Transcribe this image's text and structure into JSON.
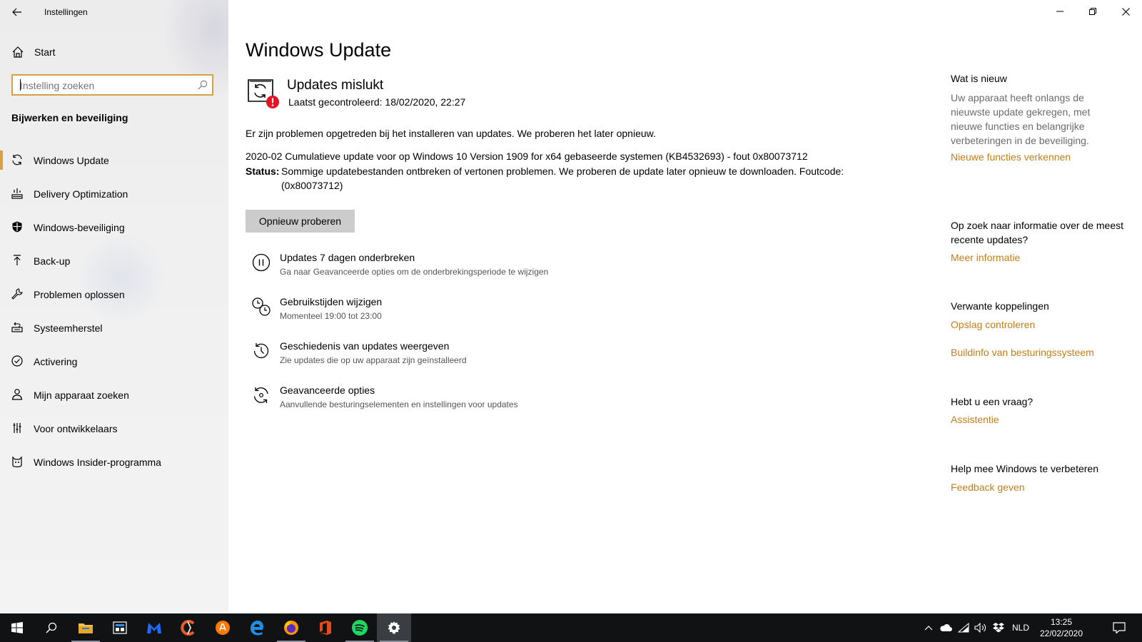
{
  "window": {
    "title": "Instellingen"
  },
  "sidebar": {
    "home_label": "Start",
    "search_placeholder": "Instelling zoeken",
    "section_title": "Bijwerken en beveiliging",
    "items": [
      {
        "label": "Windows Update",
        "icon": "sync-icon",
        "active": true
      },
      {
        "label": "Delivery Optimization",
        "icon": "delivery-icon"
      },
      {
        "label": "Windows-beveiliging",
        "icon": "shield-icon"
      },
      {
        "label": "Back-up",
        "icon": "backup-arrow-icon"
      },
      {
        "label": "Problemen oplossen",
        "icon": "wrench-icon"
      },
      {
        "label": "Systeemherstel",
        "icon": "recovery-icon"
      },
      {
        "label": "Activering",
        "icon": "check-circle-icon"
      },
      {
        "label": "Mijn apparaat zoeken",
        "icon": "person-find-icon"
      },
      {
        "label": "Voor ontwikkelaars",
        "icon": "developer-icon"
      },
      {
        "label": "Windows Insider-programma",
        "icon": "insider-cat-icon"
      }
    ]
  },
  "main": {
    "page_title": "Windows Update",
    "status_title": "Updates mislukt",
    "last_checked": "Laatst gecontroleerd: 18/02/2020, 22:27",
    "problem_text": "Er zijn problemen opgetreden bij het installeren van updates. We proberen het later opnieuw.",
    "update_name": "2020-02 Cumulatieve update voor op Windows 10 Version 1909 for x64 gebaseerde systemen (KB4532693) - fout 0x80073712",
    "status_label": "Status:",
    "status_value_line1": "Sommige updatebestanden ontbreken of vertonen problemen. We proberen de update later opnieuw te downloaden. Foutcode:",
    "status_value_line2": "(0x80073712)",
    "retry_button": "Opnieuw proberen",
    "options": [
      {
        "title": "Updates 7 dagen onderbreken",
        "subtitle": "Ga naar Geavanceerde opties om de onderbrekingsperiode te wijzigen",
        "icon": "pause-icon"
      },
      {
        "title": "Gebruikstijden wijzigen",
        "subtitle": "Momenteel 19:00 tot 23:00",
        "icon": "active-hours-icon"
      },
      {
        "title": "Geschiedenis van updates weergeven",
        "subtitle": "Zie updates die op uw apparaat zijn geïnstalleerd",
        "icon": "history-icon"
      },
      {
        "title": "Geavanceerde opties",
        "subtitle": "Aanvullende besturingselementen en instellingen voor updates",
        "icon": "advanced-sync-icon"
      }
    ]
  },
  "right": {
    "whats_new_title": "Wat is nieuw",
    "whats_new_text": "Uw apparaat heeft onlangs de nieuwste update gekregen, met nieuwe functies en belangrijke verbeteringen in de beveiliging.",
    "whats_new_link": "Nieuwe functies verkennen",
    "info_title": "Op zoek naar informatie over de meest recente updates?",
    "info_link": "Meer informatie",
    "related_title": "Verwante koppelingen",
    "related_link1": "Opslag controleren",
    "related_link2": "Buildinfo van besturingssysteem",
    "question_title": "Hebt u een vraag?",
    "question_link": "Assistentie",
    "improve_title": "Help mee Windows te verbeteren",
    "improve_link": "Feedback geven"
  },
  "taskbar": {
    "apps": [
      "windows-start-icon",
      "search-icon",
      "file-explorer-icon",
      "taskview-icon",
      "malwarebytes-icon",
      "ccleaner-icon",
      "avast-icon",
      "edge-icon",
      "firefox-icon",
      "office-icon",
      "spotify-icon",
      "settings-gear-icon"
    ],
    "language": "NLD",
    "time": "13:25",
    "date": "22/02/2020"
  },
  "colors": {
    "accent": "#d8a043",
    "link": "#c57d1a",
    "error": "#e81123",
    "taskbar": "#101214"
  }
}
